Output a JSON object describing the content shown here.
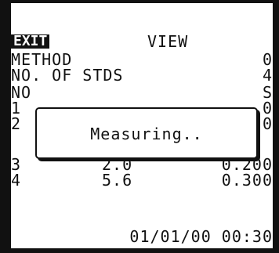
{
  "header": {
    "exit_label": "EXIT",
    "title": "VIEW"
  },
  "info": {
    "method_label": "METHOD",
    "method_value": "0",
    "stds_label": "NO. OF STDS",
    "stds_value": "4"
  },
  "table": {
    "col_no": "NO",
    "col_right_partial": "S",
    "rows": [
      {
        "no": "1",
        "a": "",
        "b": "0"
      },
      {
        "no": "2",
        "a": "",
        "b": "0"
      },
      {
        "no": "3",
        "a": "2.0",
        "b": "0.200"
      },
      {
        "no": "4",
        "a": "5.6",
        "b": "0.300"
      }
    ]
  },
  "dialog": {
    "message": "Measuring.."
  },
  "footer": {
    "datetime": "01/01/00 00:30"
  },
  "colors": {
    "foreground": "#111111",
    "background": "#ffffff"
  }
}
